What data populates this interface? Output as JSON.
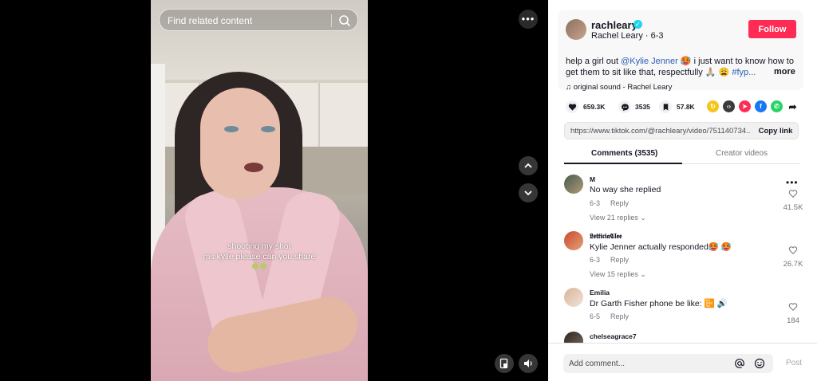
{
  "search": {
    "placeholder": "Find related content"
  },
  "video": {
    "caption_line1": "shooting my shot",
    "caption_line2": "ms kylie please can you share"
  },
  "post": {
    "username": "rachleary",
    "display_name": "Rachel Leary",
    "date": "6-3",
    "follow_label": "Follow",
    "desc_prefix": "help a girl out ",
    "mention": "@Kylie Jenner",
    "desc_rest": " 🥵  i just want to know how to get them to sit like that, respectfully 🙏🏼 😩 ",
    "hashtag": "#fyp...",
    "more_label": "more",
    "sound": "original sound - Rachel Leary"
  },
  "stats": {
    "likes": "659.3K",
    "comments": "3535",
    "saves": "57.8K"
  },
  "link": {
    "url": "https://www.tiktok.com/@rachleary/video/751140734...",
    "copy_label": "Copy link"
  },
  "tabs": [
    {
      "label": "Comments (3535)"
    },
    {
      "label": "Creator videos"
    }
  ],
  "comments": [
    {
      "user": "M",
      "text": "No way she replied",
      "date": "6-3",
      "reply": "Reply",
      "views": "View 21 replies",
      "likes": "41.5K"
    },
    {
      "user": "𝕷𝖊𝖙𝖙𝖎𝖈𝖎𝖆𝕮𝖑𝖊𝖊",
      "text": "Kylie Jenner actually responded🥵 🥵",
      "date": "6-3",
      "reply": "Reply",
      "views": "View 15 replies",
      "likes": "26.7K"
    },
    {
      "user": "Emilia",
      "text": "Dr Garth Fisher phone be like: 📴 🔊",
      "date": "6-5",
      "reply": "Reply",
      "likes": "184"
    },
    {
      "user": "chelseagrace7"
    }
  ],
  "add_comment": {
    "placeholder": "Add comment...",
    "post_label": "Post"
  },
  "colors": {
    "follow": "#fe2c55",
    "mention": "#2b5db9",
    "verified": "#20d5ec"
  }
}
